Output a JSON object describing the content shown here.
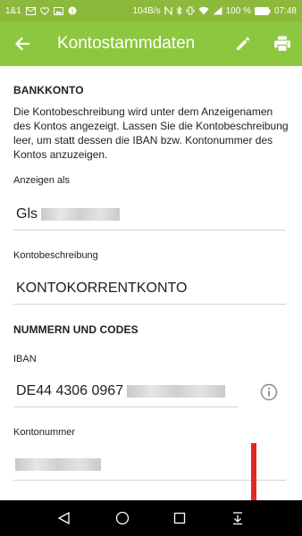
{
  "status_bar": {
    "carrier": "1&1",
    "speed": "104B/s",
    "battery": "100 %",
    "time": "07:48"
  },
  "app_bar": {
    "title": "Kontostammdaten",
    "back_icon": "arrow-back-icon",
    "edit_icon": "pencil-icon",
    "print_icon": "printer-icon"
  },
  "bank_section": {
    "title": "BANKKONTO",
    "description": "Die Kontobeschreibung wird unter dem Anzeigenamen des Kontos angezeigt. Lassen Sie die Kontobeschreibung leer, um statt dessen die IBAN bzw. Kontonummer des Kontos anzuzeigen.",
    "display_as_label": "Anzeigen als",
    "display_as_value": "Gls",
    "description_label": "Kontobeschreibung",
    "description_value": "KONTOKORRENTKONTO"
  },
  "numbers_section": {
    "title": "NUMMERN UND CODES",
    "iban_label": "IBAN",
    "iban_value": "DE44 4306 0967",
    "account_number_label": "Kontonummer"
  },
  "colors": {
    "status_bar": "#8cb93b",
    "app_bar": "#8dc63f",
    "annotation_arrow": "#e32626"
  },
  "nav_bar": {
    "back_icon": "triangle-back-icon",
    "home_icon": "circle-home-icon",
    "recents_icon": "square-recents-icon",
    "notifications_icon": "pull-down-icon"
  }
}
